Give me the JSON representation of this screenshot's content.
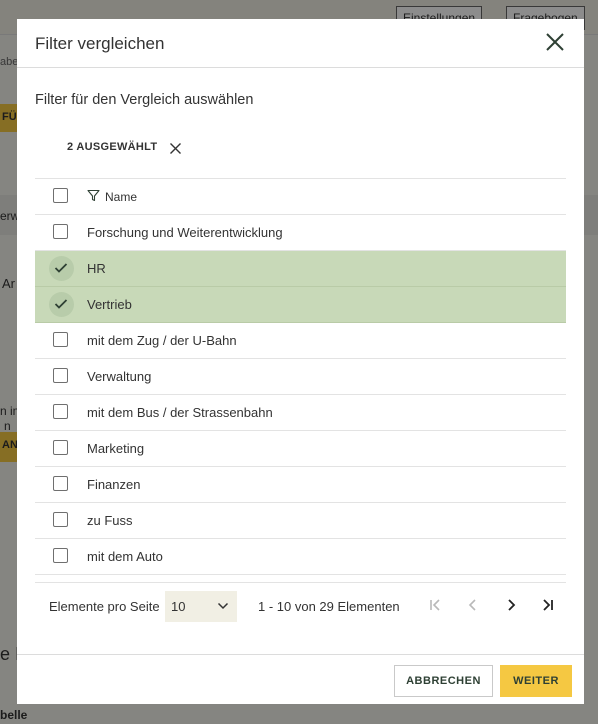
{
  "background": {
    "settings_label": "Einstellungen",
    "questions_label": "Fragebogen",
    "crumb": "abe",
    "yellow_label_1": "FÜ",
    "yellow_label_2": "ANV",
    "text_erw": "erw",
    "text_ar": "Ar",
    "text_im": "n im",
    "text_n": "n",
    "text_ih": "e Ih",
    "text_belle": "belle"
  },
  "modal": {
    "title": "Filter vergleichen",
    "subtitle": "Filter für den Vergleich auswählen",
    "selected_count": "2 AUSGEWÄHLT",
    "table": {
      "header": "Name",
      "rows": [
        {
          "name": "Forschung und Weiterentwicklung",
          "selected": false
        },
        {
          "name": "HR",
          "selected": true
        },
        {
          "name": "Vertrieb",
          "selected": true
        },
        {
          "name": "mit dem Zug / der U-Bahn",
          "selected": false
        },
        {
          "name": "Verwaltung",
          "selected": false
        },
        {
          "name": "mit dem Bus / der Strassenbahn",
          "selected": false
        },
        {
          "name": "Marketing",
          "selected": false
        },
        {
          "name": "Finanzen",
          "selected": false
        },
        {
          "name": "zu Fuss",
          "selected": false
        },
        {
          "name": "mit dem Auto",
          "selected": false
        }
      ]
    },
    "pager": {
      "per_page_label": "Elemente pro Seite",
      "per_page_value": "10",
      "range": "1 - 10 von 29 Elementen"
    },
    "footer": {
      "cancel_label": "ABBRECHEN",
      "next_label": "WEITER"
    }
  },
  "colors": {
    "accent_yellow": "#f5c842",
    "selected_row": "#c8d9b8",
    "brand_green": "#2e4034"
  }
}
